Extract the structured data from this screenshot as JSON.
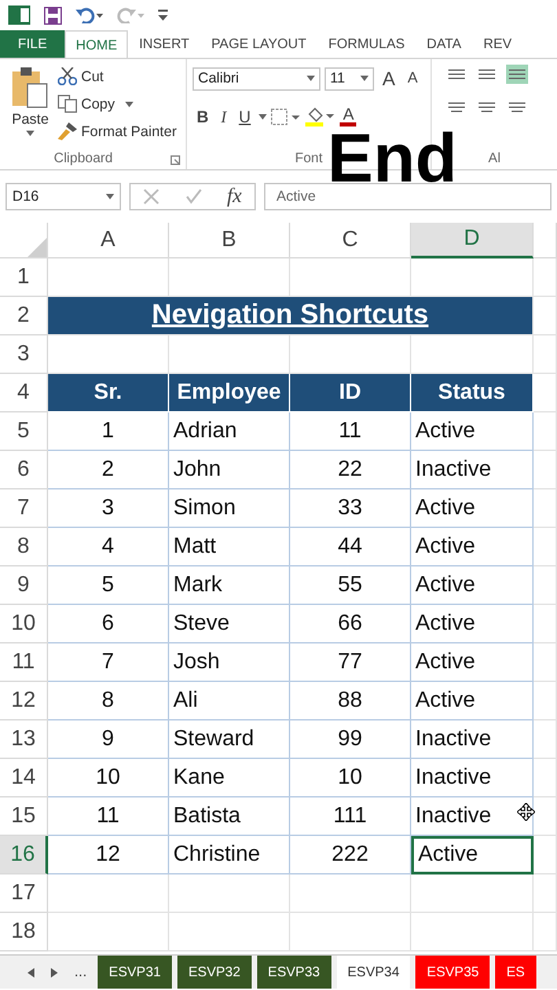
{
  "ribbon_tabs": [
    {
      "label": "FILE",
      "kind": "file",
      "selected": false
    },
    {
      "label": "HOME",
      "kind": "tab",
      "selected": true
    },
    {
      "label": "INSERT",
      "kind": "tab",
      "selected": false
    },
    {
      "label": "PAGE LAYOUT",
      "kind": "tab",
      "selected": false
    },
    {
      "label": "FORMULAS",
      "kind": "tab",
      "selected": false
    },
    {
      "label": "DATA",
      "kind": "tab",
      "selected": false
    },
    {
      "label": "REV",
      "kind": "tab",
      "selected": false
    }
  ],
  "clipboard": {
    "paste": "Paste",
    "cut": "Cut",
    "copy": "Copy",
    "format_painter": "Format Painter",
    "label": "Clipboard"
  },
  "font": {
    "name": "Calibri",
    "size": "11",
    "grow": "A",
    "shrink": "A",
    "bold": "B",
    "italic": "I",
    "underline": "U",
    "color_letter": "A",
    "label": "Font"
  },
  "alignment": {
    "label": "Al"
  },
  "caption": "End",
  "formula_bar": {
    "name_box": "D16",
    "fx": "fx",
    "value": "Active"
  },
  "columns": [
    {
      "label": "A",
      "selected": false
    },
    {
      "label": "B",
      "selected": false
    },
    {
      "label": "C",
      "selected": false
    },
    {
      "label": "D",
      "selected": true
    }
  ],
  "rows": [
    {
      "number": "1",
      "kind": "blank",
      "selected": false
    },
    {
      "number": "2",
      "kind": "title",
      "selected": false,
      "cells": [
        "Nevigation Shortcuts"
      ]
    },
    {
      "number": "3",
      "kind": "blank",
      "selected": false
    },
    {
      "number": "4",
      "kind": "header",
      "selected": false,
      "cells": [
        "Sr.",
        "Employee",
        "ID",
        "Status"
      ]
    },
    {
      "number": "5",
      "kind": "data",
      "selected": false,
      "cells": [
        "1",
        "Adrian",
        "11",
        "Active"
      ]
    },
    {
      "number": "6",
      "kind": "data",
      "selected": false,
      "cells": [
        "2",
        "John",
        "22",
        "Inactive"
      ]
    },
    {
      "number": "7",
      "kind": "data",
      "selected": false,
      "cells": [
        "3",
        "Simon",
        "33",
        "Active"
      ]
    },
    {
      "number": "8",
      "kind": "data",
      "selected": false,
      "cells": [
        "4",
        "Matt",
        "44",
        "Active"
      ]
    },
    {
      "number": "9",
      "kind": "data",
      "selected": false,
      "cells": [
        "5",
        "Mark",
        "55",
        "Active"
      ]
    },
    {
      "number": "10",
      "kind": "data",
      "selected": false,
      "cells": [
        "6",
        "Steve",
        "66",
        "Active"
      ]
    },
    {
      "number": "11",
      "kind": "data",
      "selected": false,
      "cells": [
        "7",
        "Josh",
        "77",
        "Active"
      ]
    },
    {
      "number": "12",
      "kind": "data",
      "selected": false,
      "cells": [
        "8",
        "Ali",
        "88",
        "Active"
      ]
    },
    {
      "number": "13",
      "kind": "data",
      "selected": false,
      "cells": [
        "9",
        "Steward",
        "99",
        "Inactive"
      ]
    },
    {
      "number": "14",
      "kind": "data",
      "selected": false,
      "cells": [
        "10",
        "Kane",
        "10",
        "Inactive"
      ]
    },
    {
      "number": "15",
      "kind": "data",
      "selected": false,
      "cells": [
        "11",
        "Batista",
        "111",
        "Inactive"
      ]
    },
    {
      "number": "16",
      "kind": "data",
      "selected": true,
      "cells": [
        "12",
        "Christine",
        "222",
        "Active"
      ]
    },
    {
      "number": "17",
      "kind": "blank",
      "selected": false
    },
    {
      "number": "18",
      "kind": "blank",
      "selected": false
    }
  ],
  "sheet_nav": {
    "more": "..."
  },
  "sheet_tabs": [
    {
      "label": "ESVP31",
      "color": "#375623",
      "selected": false
    },
    {
      "label": "ESVP32",
      "color": "#375623",
      "selected": false
    },
    {
      "label": "ESVP33",
      "color": "#375623",
      "selected": false
    },
    {
      "label": "ESVP34",
      "selected": true
    },
    {
      "label": "ESVP35",
      "color": "#ff0000",
      "selected": false
    },
    {
      "label": "ES",
      "color": "#ff0000",
      "selected": false
    }
  ]
}
